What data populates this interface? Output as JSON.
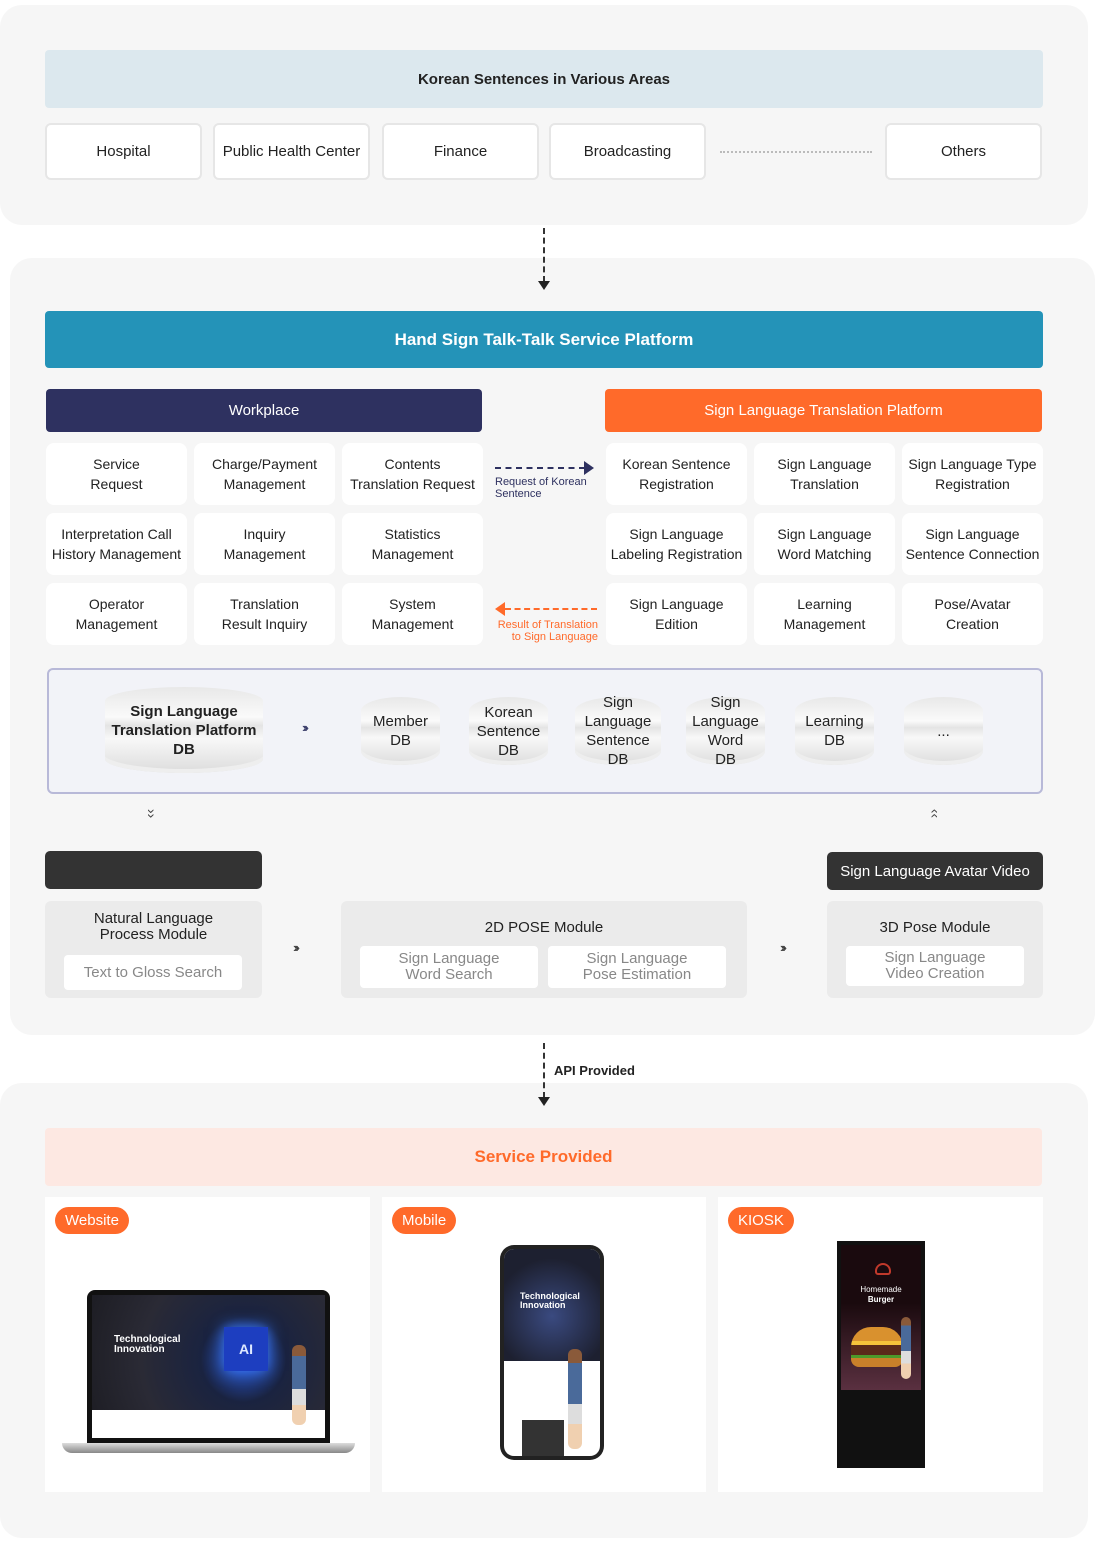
{
  "areas": {
    "title": "Korean Sentences in Various Areas",
    "items": [
      "Hospital",
      "Public Health Center",
      "Finance",
      "Broadcasting",
      "Others"
    ]
  },
  "platform": {
    "title": "Hand Sign Talk-Talk Service Platform",
    "workplace": {
      "title": "Workplace",
      "items": [
        [
          "Service",
          "Request"
        ],
        [
          "Charge/Payment",
          "Management"
        ],
        [
          "Contents",
          "Translation Request"
        ],
        [
          "Interpretation Call",
          "History Management"
        ],
        [
          "Inquiry",
          "Management"
        ],
        [
          "Statistics",
          "Management"
        ],
        [
          "Operator",
          "Management"
        ],
        [
          "Translation",
          "Result Inquiry"
        ],
        [
          "System",
          "Management"
        ]
      ]
    },
    "translation": {
      "title": "Sign Language Translation Platform",
      "items": [
        [
          "Korean Sentence",
          "Registration"
        ],
        [
          "Sign Language",
          "Translation"
        ],
        [
          "Sign Language Type",
          "Registration"
        ],
        [
          "Sign Language",
          "Labeling Registration"
        ],
        [
          "Sign Language",
          "Word Matching"
        ],
        [
          "Sign Language",
          "Sentence Connection"
        ],
        [
          "Sign Language",
          "Edition"
        ],
        [
          "Learning",
          "Management"
        ],
        [
          "Pose/Avatar",
          "Creation"
        ]
      ]
    },
    "request_label": [
      "Request of Korean",
      "Sentence"
    ],
    "result_label": [
      "Result of Translation",
      "to Sign Language"
    ],
    "colors": {
      "platform": "#2493b8",
      "workplace": "#2e3160",
      "translation": "#ff6a2a"
    }
  },
  "db": {
    "main": [
      "Sign Language",
      "Translation Platform",
      "DB"
    ],
    "items": [
      [
        "Member",
        "DB"
      ],
      [
        "Korean",
        "Sentence",
        "DB"
      ],
      [
        "Sign Language",
        "Sentence",
        "DB"
      ],
      [
        "Sign",
        "Language",
        "Word",
        "DB"
      ],
      [
        "Learning",
        "DB"
      ],
      [
        "..."
      ]
    ]
  },
  "modules": {
    "avatar_video": "Sign Language Avatar Video",
    "nlp": {
      "title": [
        "Natural Language",
        "Process Module"
      ],
      "sub": "Text to Gloss Search"
    },
    "pose2d": {
      "title": "2D POSE Module",
      "subs": [
        [
          "Sign Language",
          "Word Search"
        ],
        [
          "Sign Language",
          "Pose Estimation"
        ]
      ]
    },
    "pose3d": {
      "title": "3D Pose Module",
      "sub": [
        "Sign Language",
        "Video Creation"
      ]
    }
  },
  "api_label": "API Provided",
  "service": {
    "title": "Service Provided",
    "cards": [
      "Website",
      "Mobile",
      "KIOSK"
    ],
    "screens": {
      "headline": [
        "Technological",
        "Innovation"
      ],
      "ai": "AI",
      "kiosk": [
        "Homemade",
        "Burger"
      ]
    }
  }
}
